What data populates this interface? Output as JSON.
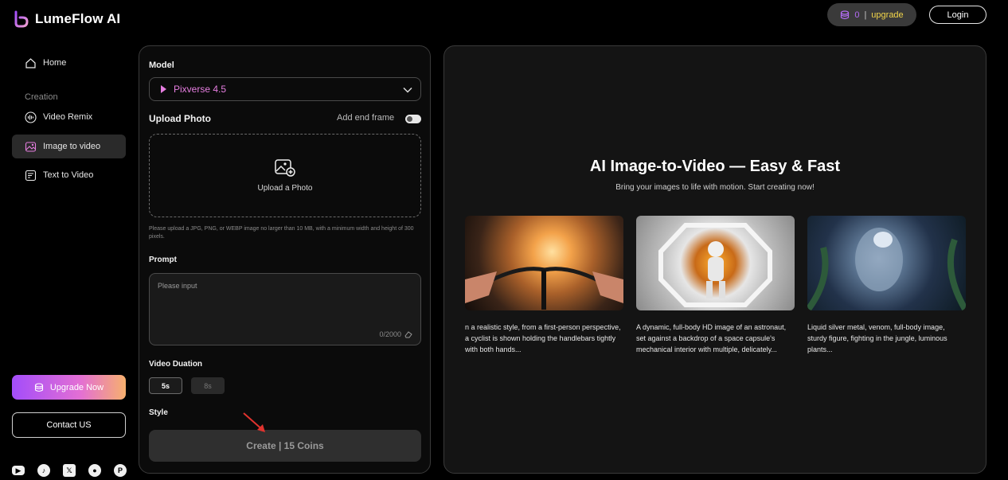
{
  "app": {
    "name": "LumeFlow AI"
  },
  "header": {
    "coins": "0",
    "upgrade_label": "upgrade",
    "login_label": "Login"
  },
  "sidebar": {
    "home": "Home",
    "section_creation": "Creation",
    "video_remix": "Video Remix",
    "image_to_video": "Image to video",
    "text_to_video": "Text to Video",
    "upgrade_now": "Upgrade Now",
    "contact": "Contact US"
  },
  "form": {
    "model_label": "Model",
    "model_value": "Pixverse 4.5",
    "upload_label": "Upload Photo",
    "end_frame_label": "Add end frame",
    "upload_cta": "Upload a Photo",
    "upload_hint": "Please upload a JPG, PNG, or WEBP image no larger than 10 MB, with a minimum width and height of 300 pixels.",
    "prompt_label": "Prompt",
    "prompt_placeholder": "Please input",
    "prompt_counter": "0/2000",
    "duration_label": "Video Duation",
    "duration_options": [
      "5s",
      "8s"
    ],
    "style_label": "Style",
    "create_label": "Create | 15 Coins"
  },
  "showcase": {
    "title": "AI Image-to-Video — Easy & Fast",
    "subtitle": "Bring your images to life with motion. Start creating now!",
    "cards": [
      {
        "text": "n a realistic style, from a first-person perspective, a cyclist is shown holding the handlebars tightly with both hands..."
      },
      {
        "text": "A dynamic, full-body HD image of an astronaut, set against a backdrop of a space capsule's mechanical interior with multiple, delicately..."
      },
      {
        "text": "Liquid silver metal, venom, full-body image, sturdy figure, fighting in the jungle, luminous plants..."
      }
    ]
  },
  "colors": {
    "accent_pink": "#e67ee0",
    "upgrade_yellow": "#f2d54a",
    "brand_gradient_start": "#a34dfa",
    "brand_gradient_end": "#f7b06e"
  }
}
